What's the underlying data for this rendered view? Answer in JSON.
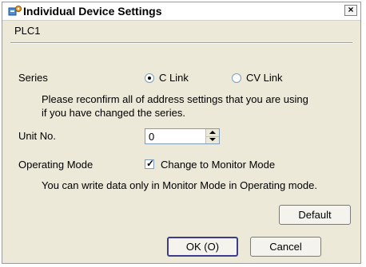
{
  "window": {
    "title": "Individual Device Settings",
    "close_glyph": "×"
  },
  "device": {
    "name": "PLC1"
  },
  "series": {
    "label": "Series",
    "options": [
      {
        "label": "C Link",
        "selected": true
      },
      {
        "label": "CV Link",
        "selected": false
      }
    ],
    "note": [
      "Please reconfirm all of address settings that you are using",
      "if you have changed the series."
    ]
  },
  "unit_no": {
    "label": "Unit No.",
    "value": "0"
  },
  "operating_mode": {
    "label": "Operating Mode",
    "checkbox_label": "Change to Monitor Mode",
    "checked": true,
    "check_glyph": "✓",
    "note": "You can write data only in Monitor Mode in Operating mode."
  },
  "buttons": {
    "default": "Default",
    "ok": "OK (O)",
    "cancel": "Cancel"
  },
  "icons": {
    "title_icon": "settings-app-icon",
    "close": "close-icon"
  }
}
